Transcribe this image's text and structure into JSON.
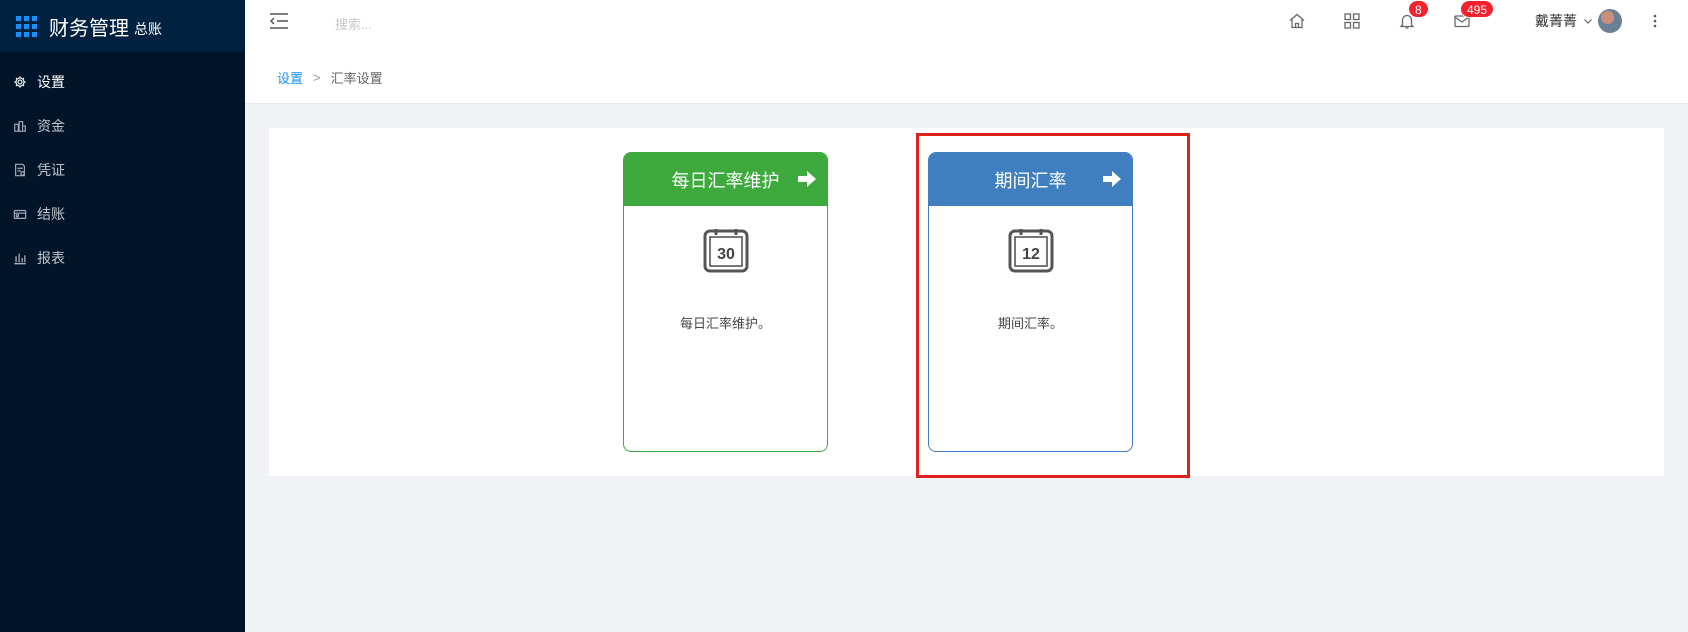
{
  "app": {
    "title": "财务管理",
    "subtitle": "总账"
  },
  "sidebar": {
    "items": [
      {
        "label": "设置",
        "icon": "gear-icon",
        "active": true
      },
      {
        "label": "资金",
        "icon": "funds-icon",
        "active": false
      },
      {
        "label": "凭证",
        "icon": "voucher-icon",
        "active": false
      },
      {
        "label": "结账",
        "icon": "wallet-icon",
        "active": false
      },
      {
        "label": "报表",
        "icon": "bar-chart-icon",
        "active": false
      }
    ]
  },
  "header": {
    "search_placeholder": "搜索...",
    "notifications_count": "8",
    "messages_count": "495",
    "user_name": "戴菁菁"
  },
  "breadcrumb": {
    "parent": "设置",
    "separator": ">",
    "current": "汇率设置"
  },
  "cards": [
    {
      "title": "每日汇率维护",
      "icon_number": "30",
      "description": "每日汇率维护。",
      "color": "#3eaa3e"
    },
    {
      "title": "期间汇率",
      "icon_number": "12",
      "description": "期间汇率。",
      "color": "#3f7fbf"
    }
  ],
  "colors": {
    "sidebar_bg": "#001529",
    "accent": "#1890ff",
    "badge": "#f5222d",
    "highlight": "#e0201c"
  }
}
